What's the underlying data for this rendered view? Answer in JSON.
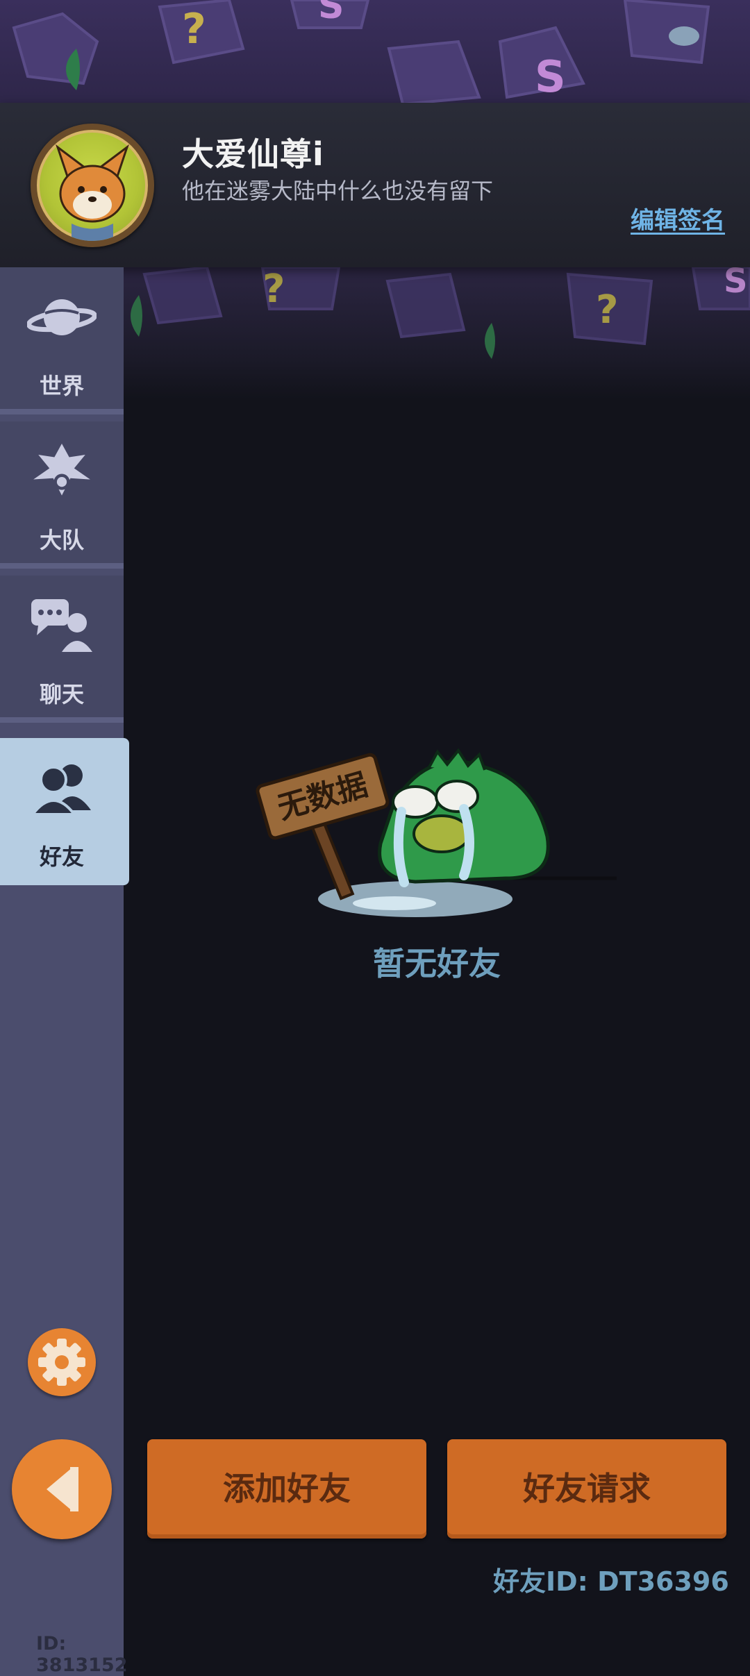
{
  "profile": {
    "nickname": "大爱仙尊i",
    "signature": "他在迷雾大陆中什么也没有留下",
    "edit_signature_label": "编辑签名"
  },
  "sidebar": {
    "items": [
      {
        "label": "世界",
        "icon": "planet-icon",
        "active": false
      },
      {
        "label": "大队",
        "icon": "team-emblem-icon",
        "active": false
      },
      {
        "label": "聊天",
        "icon": "chat-icon",
        "active": false
      },
      {
        "label": "好友",
        "icon": "friends-icon",
        "active": true
      }
    ],
    "settings_icon": "gear-icon",
    "back_icon": "back-arrow-icon",
    "user_id": "ID: 3813152"
  },
  "main": {
    "empty_sign_text": "无数据",
    "empty_text": "暂无好友",
    "buttons": {
      "add_friend": "添加好友",
      "friend_request": "好友请求"
    },
    "friend_id": "好友ID: DT36396"
  },
  "colors": {
    "accent_orange": "#e78432",
    "active_tab": "#b6cde2",
    "link_blue": "#6fb4e6",
    "muted_blue_text": "#6e9fbd"
  }
}
